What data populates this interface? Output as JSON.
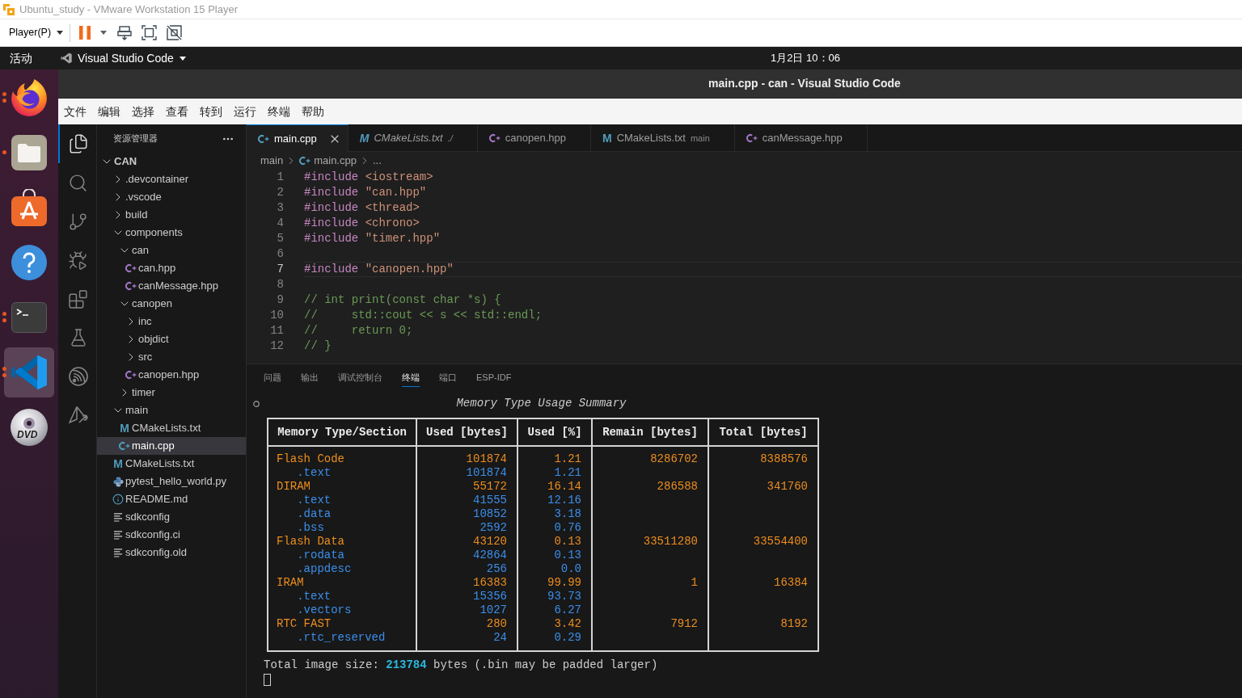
{
  "vm_window": {
    "title": "Ubuntu_study - VMware Workstation 15 Player",
    "player_menu": "Player(P)"
  },
  "top_bar": {
    "activities": "活动",
    "app_menu": "Visual Studio Code",
    "clock": "1月2日 10：06"
  },
  "dock": [
    {
      "kind": "browser",
      "selected": false,
      "running": true,
      "multi_window": true
    },
    {
      "kind": "files",
      "selected": false,
      "running": true,
      "multi_window": false
    },
    {
      "kind": "store",
      "selected": false,
      "running": false
    },
    {
      "kind": "help",
      "selected": false,
      "running": false
    },
    {
      "kind": "terminal",
      "selected": false,
      "running": true,
      "multi_window": true
    },
    {
      "kind": "editor",
      "selected": true,
      "running": true,
      "multi_window": true
    },
    {
      "kind": "disc",
      "selected": false,
      "running": false,
      "label": "DVD"
    }
  ],
  "vscode": {
    "title": "main.cpp - can - Visual Studio Code",
    "menu": [
      "文件",
      "编辑",
      "选择",
      "查看",
      "转到",
      "运行",
      "终端",
      "帮助"
    ],
    "activity_bar": [
      {
        "kind": "explorer",
        "selected": true
      },
      {
        "kind": "search",
        "selected": false
      },
      {
        "kind": "source-control",
        "selected": false
      },
      {
        "kind": "run-debug",
        "selected": false
      },
      {
        "kind": "extensions",
        "selected": false
      },
      {
        "kind": "testing",
        "selected": false
      },
      {
        "kind": "esp-idf",
        "selected": false
      },
      {
        "kind": "tools",
        "selected": false
      }
    ],
    "explorer": {
      "title": "资源管理器",
      "tree": [
        {
          "kind": "folder",
          "label": "CAN",
          "expanded": true,
          "selected": false,
          "children": [
            {
              "kind": "folder",
              "label": ".devcontainer",
              "expanded": false,
              "selected": false
            },
            {
              "kind": "folder",
              "label": ".vscode",
              "expanded": false,
              "selected": false
            },
            {
              "kind": "folder",
              "label": "build",
              "expanded": false,
              "selected": false
            },
            {
              "kind": "folder",
              "label": "components",
              "expanded": true,
              "selected": false,
              "children": [
                {
                  "kind": "folder",
                  "label": "can",
                  "expanded": true,
                  "selected": false,
                  "children": [
                    {
                      "kind": "hpp-file",
                      "label": "can.hpp",
                      "selected": false
                    },
                    {
                      "kind": "hpp-file",
                      "label": "canMessage.hpp",
                      "selected": false
                    }
                  ]
                },
                {
                  "kind": "folder",
                  "label": "canopen",
                  "expanded": true,
                  "selected": false,
                  "children": [
                    {
                      "kind": "folder",
                      "label": "inc",
                      "expanded": false,
                      "selected": false
                    },
                    {
                      "kind": "folder",
                      "label": "objdict",
                      "expanded": false,
                      "selected": false
                    },
                    {
                      "kind": "folder",
                      "label": "src",
                      "expanded": false,
                      "selected": false
                    },
                    {
                      "kind": "hpp-file",
                      "label": "canopen.hpp",
                      "selected": false
                    }
                  ]
                },
                {
                  "kind": "folder",
                  "label": "timer",
                  "expanded": false,
                  "selected": false
                }
              ]
            },
            {
              "kind": "folder",
              "label": "main",
              "expanded": true,
              "selected": false,
              "children": [
                {
                  "kind": "cmake-file",
                  "badge": "M",
                  "label": "CMakeLists.txt",
                  "selected": false
                },
                {
                  "kind": "cpp-file",
                  "label": "main.cpp",
                  "selected": true
                }
              ]
            },
            {
              "kind": "cmake-file",
              "badge": "M",
              "label": "CMakeLists.txt",
              "selected": false
            },
            {
              "kind": "python-file",
              "label": "pytest_hello_world.py",
              "selected": false
            },
            {
              "kind": "info-file",
              "label": "README.md",
              "selected": false
            },
            {
              "kind": "config-file",
              "label": "sdkconfig",
              "selected": false
            },
            {
              "kind": "config-file",
              "label": "sdkconfig.ci",
              "selected": false
            },
            {
              "kind": "config-file",
              "label": "sdkconfig.old",
              "selected": false
            }
          ]
        }
      ]
    },
    "tabs": [
      {
        "kind": "cpp-file",
        "label": "main.cpp",
        "selected": true,
        "preview": false
      },
      {
        "kind": "cmake-file",
        "badge": "M",
        "label": "CMakeLists.txt",
        "description": "./",
        "selected": false,
        "preview": true
      },
      {
        "kind": "hpp-file",
        "label": "canopen.hpp",
        "selected": false,
        "preview": false
      },
      {
        "kind": "cmake-file",
        "badge": "M",
        "label": "CMakeLists.txt",
        "description": "main",
        "selected": false,
        "preview": false
      },
      {
        "kind": "hpp-file",
        "label": "canMessage.hpp",
        "selected": false,
        "preview": false
      }
    ],
    "breadcrumbs": [
      {
        "kind": "folder",
        "label": "main"
      },
      {
        "kind": "cpp-file",
        "label": "main.cpp"
      },
      {
        "kind": "more",
        "label": "..."
      }
    ],
    "code_lines": [
      {
        "number": "1",
        "current": false,
        "tokens": [
          {
            "kind": "directive",
            "text": "#include"
          },
          {
            "kind": "string",
            "text": "<iostream>"
          }
        ]
      },
      {
        "number": "2",
        "current": false,
        "tokens": [
          {
            "kind": "directive",
            "text": "#include"
          },
          {
            "kind": "string",
            "text": "\"can.hpp\""
          }
        ]
      },
      {
        "number": "3",
        "current": false,
        "tokens": [
          {
            "kind": "directive",
            "text": "#include"
          },
          {
            "kind": "string",
            "text": "<thread>"
          }
        ]
      },
      {
        "number": "4",
        "current": false,
        "tokens": [
          {
            "kind": "directive",
            "text": "#include"
          },
          {
            "kind": "string",
            "text": "<chrono>"
          }
        ]
      },
      {
        "number": "5",
        "current": false,
        "tokens": [
          {
            "kind": "directive",
            "text": "#include"
          },
          {
            "kind": "string",
            "text": "\"timer.hpp\""
          }
        ]
      },
      {
        "number": "6",
        "current": false
      },
      {
        "number": "7",
        "current": true,
        "tokens": [
          {
            "kind": "directive",
            "text": "#include"
          },
          {
            "kind": "string",
            "text": "\"canopen.hpp\""
          }
        ]
      },
      {
        "number": "8",
        "current": false
      },
      {
        "number": "9",
        "current": false,
        "tokens": [
          {
            "kind": "comment",
            "text": "// int print(const char *s) {"
          }
        ]
      },
      {
        "number": "10",
        "current": false,
        "tokens": [
          {
            "kind": "comment",
            "text": "//     std::cout << s << std::endl;"
          }
        ]
      },
      {
        "number": "11",
        "current": false,
        "tokens": [
          {
            "kind": "comment",
            "text": "//     return 0;"
          }
        ]
      },
      {
        "number": "12",
        "current": false,
        "tokens": [
          {
            "kind": "comment",
            "text": "// }"
          }
        ]
      }
    ],
    "panel": {
      "tabs": [
        {
          "label": "问题",
          "selected": false
        },
        {
          "label": "输出",
          "selected": false
        },
        {
          "label": "调试控制台",
          "selected": false
        },
        {
          "label": "终端",
          "selected": true
        },
        {
          "label": "端口",
          "selected": false
        },
        {
          "label": "ESP-IDF",
          "selected": false
        }
      ],
      "terminal": {
        "title": "Memory Type Usage Summary",
        "columns": [
          "Memory Type/Section",
          "Used [bytes]",
          "Used [%]",
          "Remain [bytes]",
          "Total [bytes]"
        ],
        "rows": [
          {
            "cells": [
              "Flash Code",
              "101874",
              "1.21",
              "8286702",
              "8388576"
            ],
            "children": [
              {
                "cells": [
                  ".text",
                  "101874",
                  "1.21"
                ]
              }
            ]
          },
          {
            "cells": [
              "DIRAM",
              "55172",
              "16.14",
              "286588",
              "341760"
            ],
            "children": [
              {
                "cells": [
                  ".text",
                  "41555",
                  "12.16"
                ]
              },
              {
                "cells": [
                  ".data",
                  "10852",
                  "3.18"
                ]
              },
              {
                "cells": [
                  ".bss",
                  "2592",
                  "0.76"
                ]
              }
            ]
          },
          {
            "cells": [
              "Flash Data",
              "43120",
              "0.13",
              "33511280",
              "33554400"
            ],
            "children": [
              {
                "cells": [
                  ".rodata",
                  "42864",
                  "0.13"
                ]
              },
              {
                "cells": [
                  ".appdesc",
                  "256",
                  "0.0"
                ]
              }
            ]
          },
          {
            "cells": [
              "IRAM",
              "16383",
              "99.99",
              "1",
              "16384"
            ],
            "children": [
              {
                "cells": [
                  ".text",
                  "15356",
                  "93.73"
                ]
              },
              {
                "cells": [
                  ".vectors",
                  "1027",
                  "6.27"
                ]
              }
            ]
          },
          {
            "cells": [
              "RTC FAST",
              "280",
              "3.42",
              "7912",
              "8192"
            ],
            "children": [
              {
                "cells": [
                  ".rtc_reserved",
                  "24",
                  "0.29"
                ]
              }
            ]
          }
        ],
        "summary": "Total image size: **213784** bytes (.bin may be padded larger)"
      }
    }
  }
}
